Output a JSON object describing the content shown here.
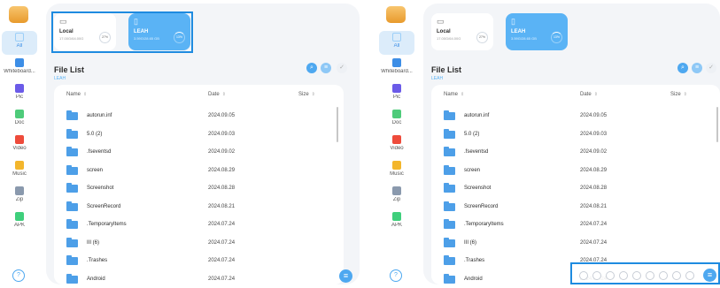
{
  "sidebar": {
    "items": [
      {
        "label": "All",
        "icon": "grid-icon",
        "color": "#9ccff8"
      },
      {
        "label": "Whiteboard...",
        "icon": "whiteboard-icon",
        "color": "#3d8ee6"
      },
      {
        "label": "Pic",
        "icon": "picture-icon",
        "color": "#6b5be8"
      },
      {
        "label": "Doc",
        "icon": "document-icon",
        "color": "#4ecb7a"
      },
      {
        "label": "Video",
        "icon": "video-icon",
        "color": "#ee4b3b"
      },
      {
        "label": "Music",
        "icon": "music-icon",
        "color": "#f3b62c"
      },
      {
        "label": "Zip",
        "icon": "zip-icon",
        "color": "#8a99ad"
      },
      {
        "label": "APK",
        "icon": "android-icon",
        "color": "#3fcf7c"
      }
    ]
  },
  "storage": {
    "local": {
      "name": "Local",
      "size": "17.00G/64.00G",
      "percent": "27%"
    },
    "usb": {
      "name": "LEAH",
      "size": "3.59G/28.65 GB",
      "percent": "13%"
    }
  },
  "file_list": {
    "title": "File List",
    "path": "LEAH",
    "columns": {
      "name": "Name",
      "date": "Date",
      "size": "Size"
    },
    "rows": [
      {
        "name": "autorun.inf",
        "date": "2024.09.05"
      },
      {
        "name": "5.0  (2)",
        "date": "2024.09.03"
      },
      {
        "name": ".fseventsd",
        "date": "2024.09.02"
      },
      {
        "name": "screen",
        "date": "2024.08.29"
      },
      {
        "name": "Screenshot",
        "date": "2024.08.28"
      },
      {
        "name": "ScreenRecord",
        "date": "2024.08.21"
      },
      {
        "name": ".TemporaryItems",
        "date": "2024.07.24"
      },
      {
        "name": "III (6)",
        "date": "2024.07.24"
      },
      {
        "name": ".Trashes",
        "date": "2024.07.24"
      },
      {
        "name": "Android",
        "date": "2024.07.24"
      }
    ]
  },
  "colors": {
    "accent": "#4ea8f0",
    "highlight": "#1e8be0"
  }
}
